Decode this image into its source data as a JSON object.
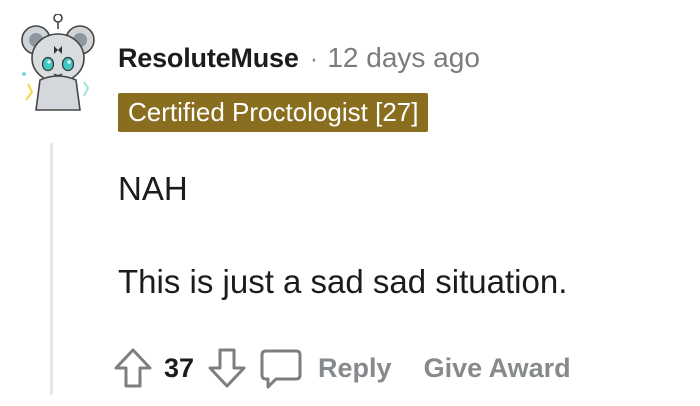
{
  "comment": {
    "author": "ResoluteMuse",
    "separator": "·",
    "time_ago": "12 days ago",
    "flair": "Certified Proctologist [27]",
    "body_lines": [
      "NAH",
      "This is just a sad sad situation."
    ]
  },
  "actions": {
    "vote_count": "37",
    "reply_label": "Reply",
    "award_label": "Give Award"
  },
  "icons": {
    "upvote": "arrow-up-outline-icon",
    "downvote": "arrow-down-outline-icon",
    "reply": "speech-bubble-icon"
  },
  "colors": {
    "flair_background": "#8a6e1f",
    "muted_text": "#878a8c",
    "primary_text": "#1c1c1c",
    "thread_line": "#e4e6e8"
  }
}
